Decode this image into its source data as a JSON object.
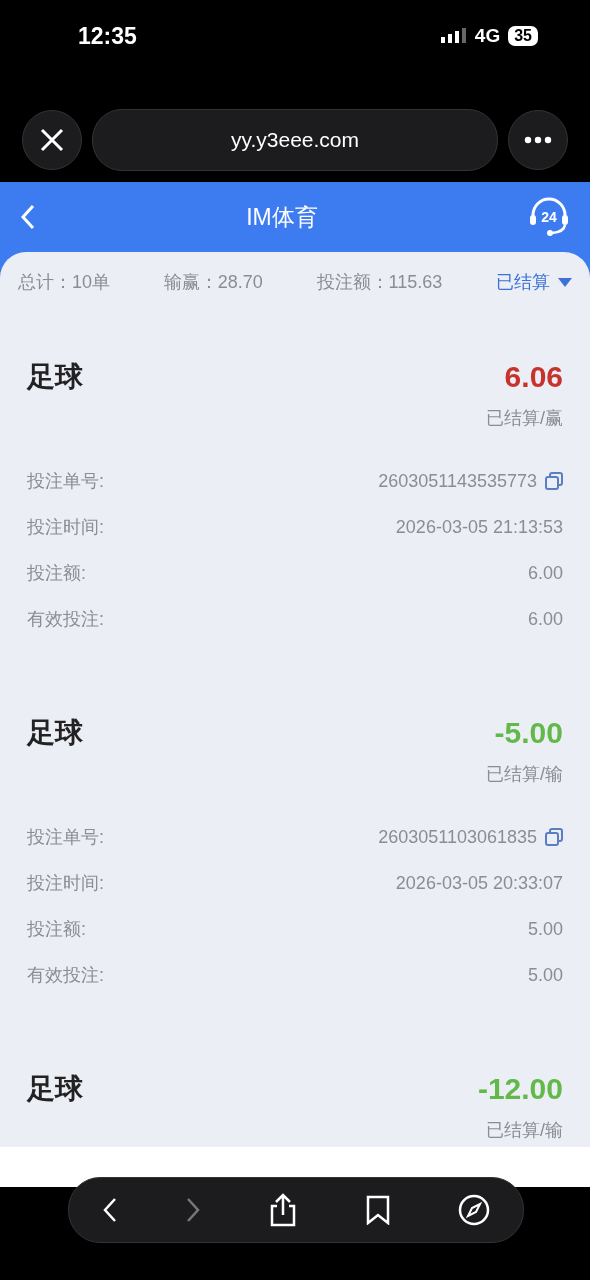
{
  "status_bar": {
    "time": "12:35",
    "network": "4G",
    "battery": "35"
  },
  "browser": {
    "url": "yy.y3eee.com"
  },
  "header": {
    "title": "IM体育",
    "support_badge": "24"
  },
  "summary": {
    "total": "总计：10单",
    "win_loss": "输赢：28.70",
    "stake": "投注额：115.63",
    "filter": "已结算"
  },
  "bets": [
    {
      "sport": "足球",
      "amount": "6.06",
      "won": true,
      "status": "已结算/赢",
      "details": [
        {
          "label": "投注单号:",
          "value": "2603051143535773",
          "kind": "copy"
        },
        {
          "label": "投注时间:",
          "value": "2026-03-05 21:13:53",
          "kind": "plain"
        },
        {
          "label": "投注额:",
          "value": "6.00",
          "kind": "plain"
        },
        {
          "label": "有效投注:",
          "value": "6.00",
          "kind": "plain"
        }
      ]
    },
    {
      "sport": "足球",
      "amount": "-5.00",
      "won": false,
      "status": "已结算/输",
      "details": [
        {
          "label": "投注单号:",
          "value": "2603051103061835",
          "kind": "copy"
        },
        {
          "label": "投注时间:",
          "value": "2026-03-05 20:33:07",
          "kind": "plain"
        },
        {
          "label": "投注额:",
          "value": "5.00",
          "kind": "plain"
        },
        {
          "label": "有效投注:",
          "value": "5.00",
          "kind": "plain"
        }
      ]
    },
    {
      "sport": "足球",
      "amount": "-12.00",
      "won": false,
      "status": "已结算/输"
    }
  ]
}
